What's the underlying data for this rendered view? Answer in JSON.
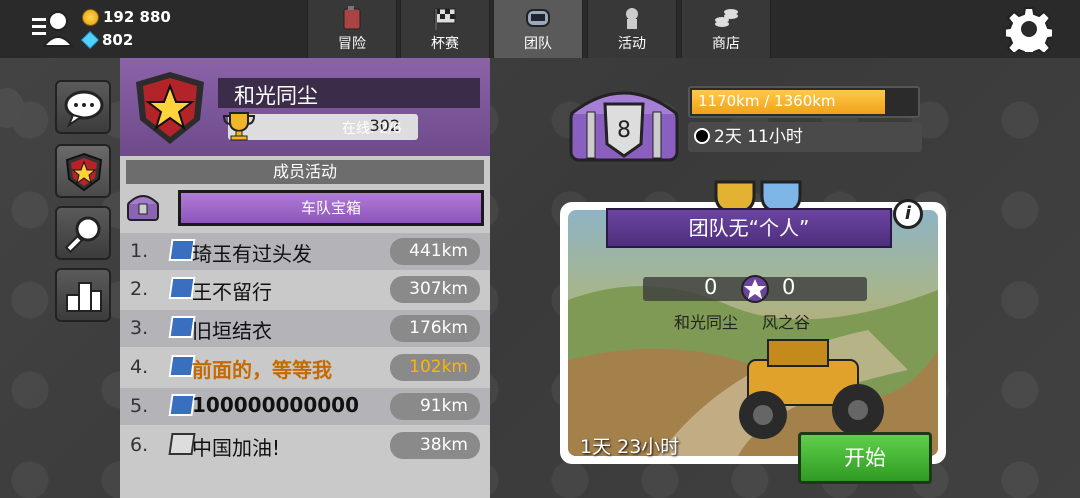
{
  "currency": {
    "coins": "192 880",
    "gems": "802"
  },
  "tabs": [
    {
      "label": "冒险"
    },
    {
      "label": "杯赛"
    },
    {
      "label": "团队"
    },
    {
      "label": "活动"
    },
    {
      "label": "商店"
    }
  ],
  "team": {
    "name": "和光同尘",
    "trophies": "302",
    "online": "在线: 2/6",
    "activity_title": "成员活动",
    "chest_label": "车队宝箱"
  },
  "members": [
    {
      "rank": "1.",
      "name": "琦玉有过头发",
      "distance": "441km"
    },
    {
      "rank": "2.",
      "name": "王不留行",
      "distance": "307km"
    },
    {
      "rank": "3.",
      "name": "旧垣结衣",
      "distance": "176km"
    },
    {
      "rank": "4.",
      "name": "前面的，等等我",
      "distance": "102km"
    },
    {
      "rank": "5.",
      "name": "100000000000",
      "distance": "91km"
    },
    {
      "rank": "6.",
      "name": "中国加油!",
      "distance": "38km"
    }
  ],
  "chest": {
    "level": "8",
    "progress_text": "1170km / 1360km",
    "progress_fraction": 0.86,
    "timer": "2天 11小时"
  },
  "event": {
    "title": "团队无“个人”",
    "info": "i",
    "score_left": "0",
    "score_right": "0",
    "team_left": "和光同尘",
    "team_right": "风之谷",
    "timer": "1天 23小时",
    "start_label": "开始"
  },
  "colors": {
    "accent_purple": "#7a52a0",
    "progress_orange": "#f0a21a",
    "start_green": "#3fae2e",
    "highlight_orange": "#c56a00"
  }
}
